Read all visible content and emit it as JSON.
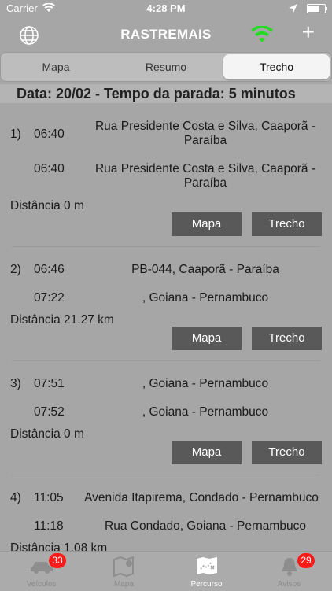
{
  "status_bar": {
    "carrier": "Carrier",
    "time": "4:28 PM"
  },
  "nav": {
    "title": "RASTREMAIS"
  },
  "segments": {
    "mapa": "Mapa",
    "resumo": "Resumo",
    "trecho": "Trecho",
    "selected": "Trecho"
  },
  "date_header": "Data: 20/02 - Tempo da parada: 5 minutos",
  "entries": [
    {
      "index": "1)",
      "start_time": "06:40",
      "start_address": "Rua Presidente Costa e Silva, Caaporã - Paraíba",
      "end_time": "06:40",
      "end_address": "Rua Presidente Costa e Silva, Caaporã - Paraíba",
      "distance": "Distância 0 m",
      "map_button": "Mapa",
      "route_button": "Trecho"
    },
    {
      "index": "2)",
      "start_time": "06:46",
      "start_address": "PB-044, Caaporã - Paraíba",
      "end_time": "07:22",
      "end_address": ", Goiana - Pernambuco",
      "distance": "Distância 21.27 km",
      "map_button": "Mapa",
      "route_button": "Trecho"
    },
    {
      "index": "3)",
      "start_time": "07:51",
      "start_address": ", Goiana - Pernambuco",
      "end_time": "07:52",
      "end_address": ", Goiana - Pernambuco",
      "distance": "Distância 0 m",
      "map_button": "Mapa",
      "route_button": "Trecho"
    },
    {
      "index": "4)",
      "start_time": "11:05",
      "start_address": "Avenida Itapirema, Condado - Pernambuco",
      "end_time": "11:18",
      "end_address": "Rua Condado, Goiana - Pernambuco",
      "distance": "Distância 1.08 km"
    }
  ],
  "tabbar": {
    "veiculos": {
      "label": "Veículos",
      "badge": "33"
    },
    "mapa": {
      "label": "Mapa"
    },
    "percurso": {
      "label": "Percurso"
    },
    "avisos": {
      "label": "Avisos",
      "badge": "29"
    }
  },
  "colors": {
    "background": "#a6a6a6",
    "button": "#595959",
    "badge": "#ff1a1a",
    "wifi_green": "#22dd22"
  }
}
